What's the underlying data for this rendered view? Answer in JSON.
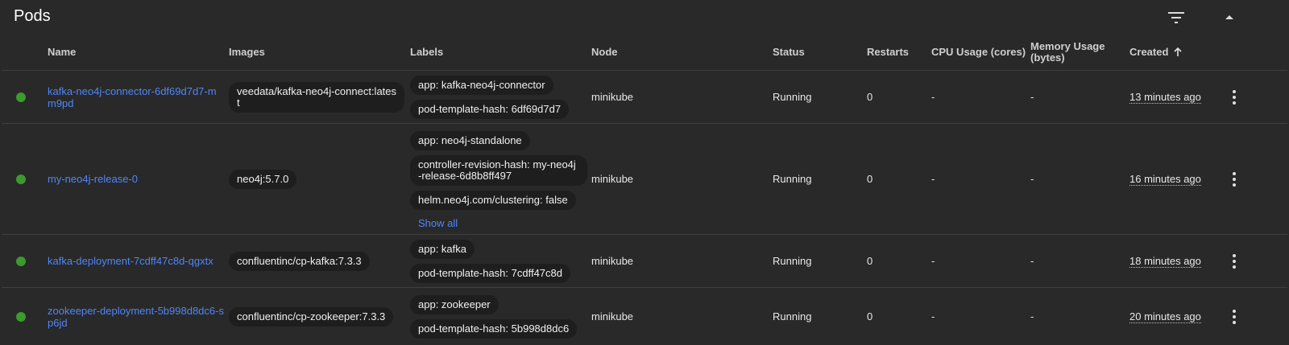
{
  "header": {
    "title": "Pods"
  },
  "columns": {
    "name": "Name",
    "images": "Images",
    "labels": "Labels",
    "node": "Node",
    "status": "Status",
    "restarts": "Restarts",
    "cpu": "CPU Usage (cores)",
    "memory_line1": "Memory Usage",
    "memory_line2": "(bytes)",
    "created": "Created"
  },
  "rows": [
    {
      "name": "kafka-neo4j-connector-6df69d7d7-mm9pd",
      "image": "veedata/kafka-neo4j-connect:latest",
      "labels": [
        "app: kafka-neo4j-connector",
        "pod-template-hash: 6df69d7d7"
      ],
      "node": "minikube",
      "status": "Running",
      "restarts": "0",
      "cpu": "-",
      "memory": "-",
      "created": "13 minutes ago"
    },
    {
      "name": "my-neo4j-release-0",
      "image": "neo4j:5.7.0",
      "labels": [
        "app: neo4j-standalone",
        "controller-revision-hash: my-neo4j-release-6d8b8ff497",
        "helm.neo4j.com/clustering: false"
      ],
      "show_all": "Show all",
      "node": "minikube",
      "status": "Running",
      "restarts": "0",
      "cpu": "-",
      "memory": "-",
      "created": "16 minutes ago"
    },
    {
      "name": "kafka-deployment-7cdff47c8d-qgxtx",
      "image": "confluentinc/cp-kafka:7.3.3",
      "labels": [
        "app: kafka",
        "pod-template-hash: 7cdff47c8d"
      ],
      "node": "minikube",
      "status": "Running",
      "restarts": "0",
      "cpu": "-",
      "memory": "-",
      "created": "18 minutes ago"
    },
    {
      "name": "zookeeper-deployment-5b998d8dc6-sp6jd",
      "image": "confluentinc/cp-zookeeper:7.3.3",
      "labels": [
        "app: zookeeper",
        "pod-template-hash: 5b998d8dc6"
      ],
      "node": "minikube",
      "status": "Running",
      "restarts": "0",
      "cpu": "-",
      "memory": "-",
      "created": "20 minutes ago"
    }
  ],
  "colors": {
    "running": "#3c9a2e",
    "link": "#4f86f7",
    "background": "#292929"
  },
  "icons": {
    "filter": "filter-list-icon",
    "collapse": "chevron-up-icon",
    "sort": "arrow-up-icon",
    "menu": "more-vert-icon"
  }
}
